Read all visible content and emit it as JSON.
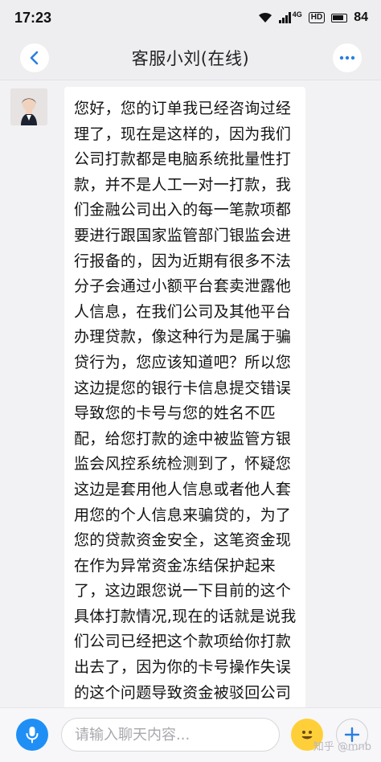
{
  "status_bar": {
    "time": "17:23",
    "network": "4G",
    "hd": "HD",
    "battery": "84"
  },
  "header": {
    "title": "客服小刘(在线)",
    "back_icon": "chevron-left-icon",
    "more_icon": "ellipsis-icon"
  },
  "chat": {
    "messages": [
      {
        "sender": "agent",
        "text": "您好，您的订单我已经咨询过经理了，现在是这样的，因为我们公司打款都是电脑系统批量性打款，并不是人工一对一打款，我们金融公司出入的每一笔款项都要进行跟国家监管部门银监会进行报备的，因为近期有很多不法分子会通过小额平台套卖泄露他人信息，在我们公司及其他平台办理贷款，像这种行为是属于骗贷行为，您应该知道吧？所以您这边提您的银行卡信息提交错误导致您的卡号与您的姓名不匹配，给您打款的途中被监管方银监会风控系统检测到了，怀疑您这边是套用他人信息或者他人套用您的个人信息来骗贷的，为了您的贷款资金安全，这笔资金现在作为异常资金冻结保护起来了，这边跟您说一下目前的这个具体打款情况,现在的话就是说我们公司已经把这个款项给你打款出去了，因为你的卡号操作失误的这个问题导致资金被驳回公司的途中被第三方检查到异常并且冻结监管起来了，现在这个资金没有回到我们公司也没"
      }
    ]
  },
  "input_bar": {
    "placeholder": "请输入聊天内容..."
  },
  "watermark": "知乎 @mnb",
  "colors": {
    "accent": "#1f8ff5",
    "emoji": "#ffcf3a",
    "background": "#f2f2f4"
  }
}
